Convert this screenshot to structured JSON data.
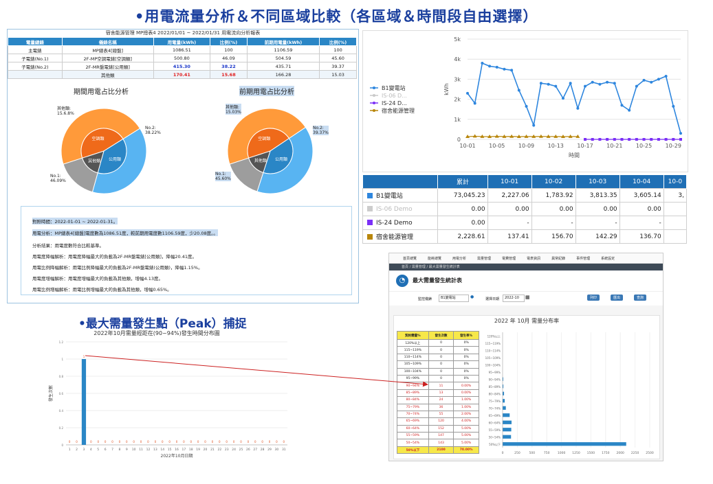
{
  "headings": {
    "main": "•用電流量分析＆不同區域比較（各區域＆時間段自由選擇）",
    "peak": "•最大需量發生點（Peak）捕捉"
  },
  "report": {
    "title": "宿舍能源管理 MP總表4 2022/01/01 ~ 2022/01/31 用電流向分析報表",
    "columns": [
      "電量總錶",
      "儀錶名稱",
      "用電量(kWh)",
      "比例(%)",
      "前期用電量(kWh)",
      "比例(%)"
    ],
    "rows": [
      [
        "主電錶",
        "MP總表4[總盤]",
        "1086.51",
        "100",
        "1106.59",
        "100"
      ],
      [
        "子電錶(No.1)",
        "2F-MP空調電錶[空調類]",
        "500.80",
        "46.09",
        "504.59",
        "45.60"
      ],
      [
        "子電錶(No.2)",
        "2F-MR盤電錶[公用類]",
        "415.30",
        "38.22",
        "435.71",
        "39.37"
      ],
      [
        "",
        "其他類",
        "170.41",
        "15.68",
        "166.28",
        "15.03"
      ]
    ],
    "pie_current": {
      "title": "期間用電占比分析",
      "labels": {
        "other": "其他類:\n15.6.8%",
        "no2": "No.2:\n38.22%",
        "no1": "No.1:\n46.09%"
      },
      "inner": {
        "other": "其他類",
        "public": "公用類",
        "aircon": "空調類"
      },
      "slices": [
        46.09,
        38.22,
        15.68
      ]
    },
    "pie_previous": {
      "title": "前期用電占比分析",
      "labels": {
        "other": "其他類:\n15.03%",
        "no2": "No.2:\n39.37%",
        "no1": "No.1:\n45.60%"
      },
      "inner": {
        "other": "其他類",
        "public": "公用類",
        "aircon": "空調類"
      },
      "slices": [
        45.6,
        39.37,
        15.03
      ]
    },
    "analysis": [
      "對照時間：2022-01-01 ~ 2022-01-31。",
      "用電分析：MP總表4[總盤]電度數為1086.51度，較前期用電度數1106.59度，少20.08度。。",
      "分析結果：用電度數符合比較基準。",
      "用電度降幅解析：用電度降幅最大的負載為2F-MR盤電錶[公用類]，降幅20.41度。",
      "用電比例降幅解析：用電比例降幅最大的負載為2F-MR盤電錶(公用類)，降幅1.15%。",
      "用電度增幅解析：用電度增幅最大的負載為其他類，增幅4.13度。",
      "用電比例增幅解析：用電比例增幅最大的負載為其他類，增幅0.65%。"
    ]
  },
  "trend": {
    "ylabel": "kWh",
    "xlabel": "時間",
    "yticks": [
      "0",
      "1k",
      "2k",
      "3k",
      "4k",
      "5k"
    ],
    "xticks": [
      "10-01",
      "10-05",
      "10-09",
      "10-13",
      "10-17",
      "10-21",
      "10-25",
      "10-29"
    ],
    "legend": [
      "B1變電站",
      "IS-06 D...",
      "IS-24 D...",
      "宿舍能源管理"
    ]
  },
  "chart_data": [
    {
      "type": "line",
      "xlabel": "時間",
      "ylabel": "kWh",
      "ylim": [
        0,
        5000
      ],
      "x": [
        "10-01",
        "10-02",
        "10-03",
        "10-04",
        "10-05",
        "10-06",
        "10-07",
        "10-08",
        "10-09",
        "10-10",
        "10-11",
        "10-12",
        "10-13",
        "10-14",
        "10-15",
        "10-16",
        "10-17",
        "10-18",
        "10-19",
        "10-20",
        "10-21",
        "10-22",
        "10-23",
        "10-24",
        "10-25",
        "10-26",
        "10-27",
        "10-28",
        "10-29",
        "10-30"
      ],
      "series": [
        {
          "name": "B1變電站",
          "color": "#2e86de",
          "values": [
            2300,
            1800,
            3800,
            3650,
            3600,
            3500,
            3450,
            2450,
            1650,
            700,
            2800,
            2750,
            2650,
            2050,
            2800,
            1550,
            2650,
            2850,
            2750,
            2850,
            2800,
            1700,
            1450,
            2650,
            2950,
            2850,
            3000,
            3150,
            1650,
            300
          ]
        },
        {
          "name": "IS-06 D...",
          "color": "#c9c9c9",
          "values": [
            null,
            null,
            null,
            null,
            null,
            null,
            null,
            null,
            null,
            null,
            null,
            null,
            null,
            null,
            null,
            null,
            0,
            0,
            0,
            0,
            0,
            0,
            0,
            0,
            0,
            0,
            0,
            0,
            0,
            0
          ]
        },
        {
          "name": "IS-24 D...",
          "color": "#7b2ff7",
          "values": [
            null,
            null,
            null,
            null,
            null,
            null,
            null,
            null,
            null,
            null,
            null,
            null,
            null,
            null,
            null,
            null,
            0,
            0,
            0,
            0,
            0,
            0,
            0,
            0,
            0,
            0,
            0,
            0,
            0,
            0
          ]
        },
        {
          "name": "宿舍能源管理",
          "color": "#b8860b",
          "values": [
            137.41,
            156.7,
            142.29,
            136.7,
            150,
            140,
            145,
            138,
            142,
            140,
            145,
            143,
            140,
            138,
            142,
            140,
            null,
            null,
            null,
            null,
            null,
            null,
            null,
            null,
            null,
            null,
            null,
            null,
            null,
            null
          ]
        }
      ]
    },
    {
      "type": "bar",
      "title": "2022年10月需量經距在(90~94%)發生時間分布圖",
      "xlabel": "2022年10月日期",
      "ylabel": "發生次數",
      "ylim": [
        0,
        1.2
      ],
      "categories": [
        "1",
        "2",
        "3",
        "4",
        "5",
        "6",
        "7",
        "8",
        "9",
        "10",
        "11",
        "12",
        "13",
        "14",
        "15",
        "16",
        "17",
        "18",
        "19",
        "20",
        "21",
        "22",
        "23",
        "24",
        "25",
        "26",
        "27",
        "28",
        "29",
        "30",
        "31"
      ],
      "values": [
        0,
        0,
        1,
        0,
        0,
        0,
        0,
        0,
        0,
        0,
        0,
        0,
        0,
        0,
        0,
        0,
        0,
        0,
        0,
        0,
        0,
        0,
        0,
        0,
        0,
        0,
        0,
        0,
        0,
        0,
        0
      ]
    },
    {
      "type": "bar",
      "title": "2022 年 10月 需量分布率",
      "categories": [
        "120%以上",
        "115~119%",
        "110~114%",
        "105~109%",
        "100~104%",
        "95~99%",
        "90~94%",
        "85~89%",
        "80~84%",
        "75~79%",
        "70~74%",
        "65~69%",
        "60~64%",
        "55~59%",
        "50~54%",
        "50%以下"
      ],
      "values": [
        0,
        0,
        0,
        0,
        0,
        0,
        11,
        13,
        24,
        36,
        55,
        120,
        152,
        147,
        143,
        2100
      ],
      "xticks": [
        "0",
        "250",
        "500",
        "750",
        "1000",
        "1250",
        "1500",
        "1750",
        "2000",
        "2250",
        "2500"
      ]
    }
  ],
  "summary_table": {
    "headers": [
      "",
      "累計",
      "10-01",
      "10-02",
      "10-03",
      "10-04",
      "10-0"
    ],
    "rows": [
      {
        "name": "B1變電站",
        "color": "#2e86de",
        "values": [
          "73,045.23",
          "2,227.06",
          "1,783.92",
          "3,813.35",
          "3,605.14",
          "3,"
        ]
      },
      {
        "name": "IS-06 Demo",
        "color": "#cccccc",
        "values": [
          "0.00",
          "0.00",
          "0.00",
          "0.00",
          "0.00",
          ""
        ]
      },
      {
        "name": "IS-24 Demo",
        "color": "#7b2ff7",
        "values": [
          "0.00",
          "-",
          "-",
          "-",
          "-",
          ""
        ]
      },
      {
        "name": "宿舍能源管理",
        "color": "#b8860b",
        "values": [
          "2,228.61",
          "137.41",
          "156.70",
          "142.29",
          "136.70",
          ""
        ]
      }
    ]
  },
  "peak_chart": {
    "title": "2022年10月需量經距在(90~94%)發生時間分布圖",
    "xlabel": "2022年10月日期",
    "ylabel": "發生次數"
  },
  "demand_app": {
    "nav": [
      "首頁總覽",
      "能耗總覽",
      "用電分析",
      "需量管理",
      "電費管理",
      "電表資訊",
      "異常紀錄",
      "事件管理",
      "系統設定"
    ],
    "breadcrumb": "首頁 / 需量管理 / 最大需量發生統計表",
    "page_title": "最大需量發生統計表",
    "meter_label": "監控儀錶",
    "meter_value": "B1變電站",
    "date_label": "選擇日期",
    "date_value": "2022-10",
    "btn_print": "列印",
    "btn_export": "匯出",
    "btn_query": "查詢",
    "chart_title": "2022 年 10月 需量分布率",
    "table_headers": [
      "契約需量%",
      "發生次數",
      "發生率%"
    ],
    "table_rows": [
      [
        "120%以上",
        "0",
        "0%"
      ],
      [
        "115~119%",
        "0",
        "0%"
      ],
      [
        "110~114%",
        "0",
        "0%"
      ],
      [
        "105~109%",
        "0",
        "0%"
      ],
      [
        "100~104%",
        "0",
        "0%"
      ],
      [
        "95~99%",
        "0",
        "0%"
      ],
      [
        "90~94%",
        "11",
        "0.00%"
      ],
      [
        "85~89%",
        "13",
        "0.00%"
      ],
      [
        "80~84%",
        "24",
        "1.00%"
      ],
      [
        "75~79%",
        "36",
        "1.00%"
      ],
      [
        "70~74%",
        "55",
        "2.00%"
      ],
      [
        "65~69%",
        "120",
        "4.00%"
      ],
      [
        "60~64%",
        "152",
        "5.00%"
      ],
      [
        "55~59%",
        "147",
        "5.00%"
      ],
      [
        "50~54%",
        "143",
        "5.00%"
      ],
      [
        "50%以下",
        "2100",
        "70.00%"
      ]
    ]
  },
  "colors": {
    "heading": "#1a3f9e",
    "header_blue": "#2a86c6",
    "table_blue": "#1f6fb5",
    "arrow": "#cc2020"
  }
}
